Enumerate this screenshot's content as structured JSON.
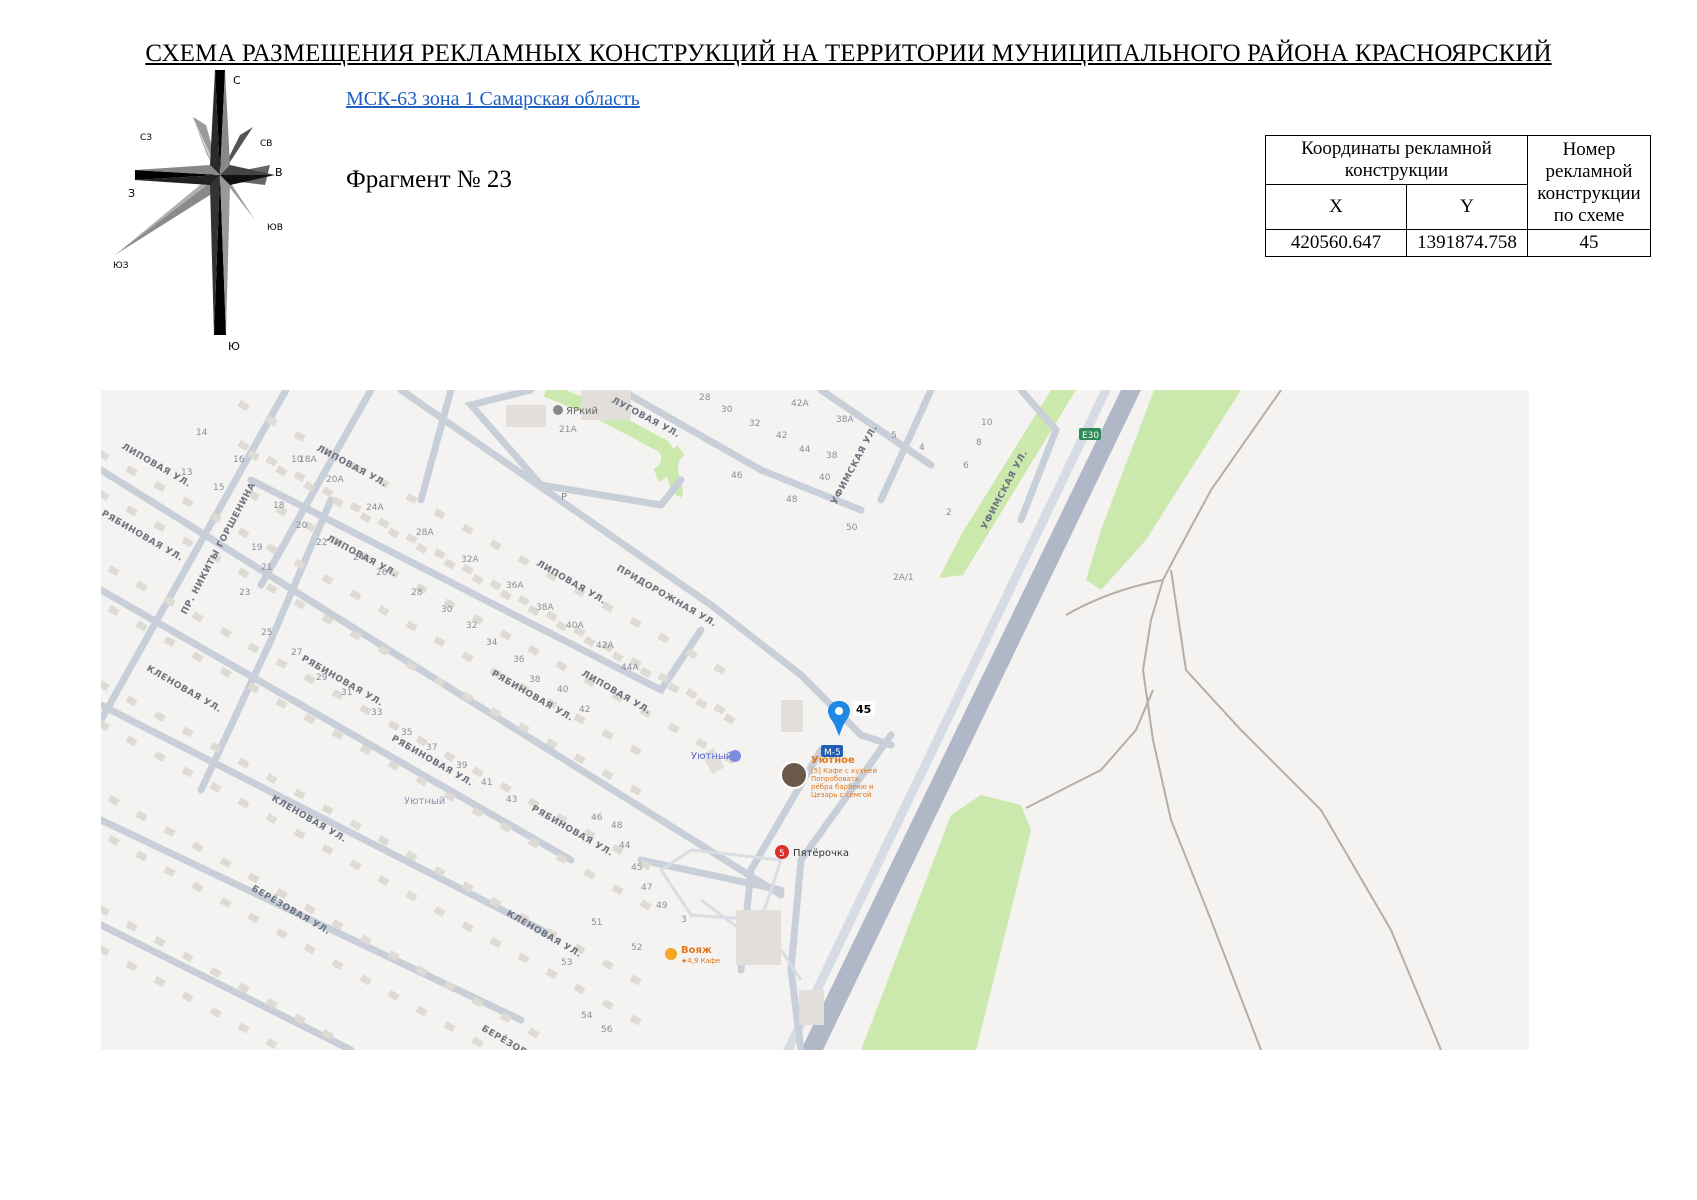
{
  "header": {
    "title": "СХЕМА РАЗМЕЩЕНИЯ РЕКЛАМНЫХ КОНСТРУКЦИЙ НА ТЕРРИТОРИИ МУНИЦИПАЛЬНОГО РАЙОНА КРАСНОЯРСКИЙ",
    "crs_link": "МСК-63 зона 1 Самарская область",
    "fragment": "Фрагмент № 23"
  },
  "compass": {
    "n": "С",
    "ne": "СВ",
    "e": "В",
    "se": "ЮВ",
    "s": "Ю",
    "sw": "ЮЗ",
    "w": "З",
    "nw": "СЗ"
  },
  "coords_table": {
    "head_coords": "Координаты рекламной конструкции",
    "head_number": "Номер рекламной конструкции по схеме",
    "col_x": "X",
    "col_y": "Y",
    "row": {
      "x": "420560.647",
      "y": "1391874.758",
      "number": "45"
    }
  },
  "map": {
    "marker_label": "45",
    "streets": [
      "ЛИПОВАЯ УЛ.",
      "ЛУГОВАЯ УЛ.",
      "УФИМСКАЯ УЛ.",
      "ПРИДОРОЖНАЯ УЛ.",
      "РЯБИНОВАЯ УЛ.",
      "КЛЕНОВАЯ УЛ.",
      "БЕРЁЗОВАЯ УЛ.",
      "ПР. НИКИТЫ ГОРШЕНИНА"
    ],
    "road_badges": {
      "e30": "E30",
      "m5": "M-5"
    },
    "poi": {
      "yarkiy": "ЯРкий",
      "uyutny_hotel": "Уютный",
      "uyutnoe_name": "Уютное",
      "uyutnoe_desc1": "[5] Кафе с кухней",
      "uyutnoe_desc2": "Попробовать",
      "uyutnoe_desc3": "рёбра барбекю и",
      "uyutnoe_desc4": "Цезарь с сёмгой",
      "pyaterochka": "Пятёрочка",
      "voyazh_name": "Вояж",
      "voyazh_desc": "★4,9 Кафе",
      "district": "Уютный",
      "parking": "P"
    },
    "house_numbers": [
      "10",
      "14",
      "16",
      "13",
      "15",
      "18А",
      "20А",
      "24А",
      "28А",
      "32А",
      "36А",
      "38А",
      "40А",
      "42А",
      "44А",
      "28",
      "30",
      "32",
      "42",
      "44",
      "42А",
      "38А",
      "38",
      "40",
      "46",
      "48",
      "50",
      "21А",
      "18",
      "20",
      "22",
      "24",
      "26",
      "28",
      "30",
      "32",
      "34",
      "36",
      "38",
      "40",
      "42",
      "44",
      "46",
      "48",
      "45",
      "47",
      "49",
      "51",
      "52",
      "53",
      "54",
      "56",
      "3",
      "4",
      "5",
      "6",
      "8",
      "2",
      "10",
      "2А/1",
      "19",
      "21",
      "23",
      "25",
      "27",
      "29",
      "31",
      "33",
      "35",
      "37",
      "39",
      "41",
      "43"
    ]
  },
  "colors": {
    "road": "#b0b8c8",
    "green": "#cce9ad",
    "map_bg": "#f4f3f1",
    "marker": "#1e88e5"
  }
}
